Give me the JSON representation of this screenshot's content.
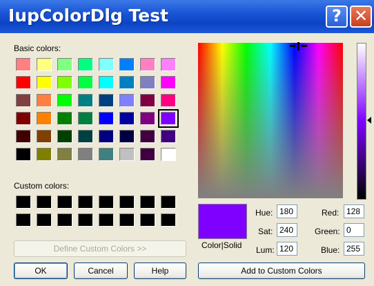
{
  "window": {
    "title": "IupColorDlg Test",
    "help_glyph": "?",
    "close_glyph": "✕"
  },
  "basic_colors": {
    "label": "Basic colors:",
    "rows": [
      [
        "#ff8080",
        "#ffff80",
        "#80ff80",
        "#00ff80",
        "#80ffff",
        "#0080ff",
        "#ff80c0",
        "#ff80ff"
      ],
      [
        "#ff0000",
        "#ffff00",
        "#80ff00",
        "#00ff40",
        "#00ffff",
        "#0080c0",
        "#8080c0",
        "#ff00ff"
      ],
      [
        "#804040",
        "#ff8040",
        "#00ff00",
        "#008080",
        "#004080",
        "#8080ff",
        "#800040",
        "#ff0080"
      ],
      [
        "#800000",
        "#ff8000",
        "#008000",
        "#008040",
        "#0000ff",
        "#0000a0",
        "#800080",
        "#8000ff"
      ],
      [
        "#400000",
        "#804000",
        "#004000",
        "#004040",
        "#000080",
        "#000040",
        "#400040",
        "#400080"
      ],
      [
        "#000000",
        "#808000",
        "#808040",
        "#808080",
        "#408080",
        "#c0c0c0",
        "#400040",
        "#ffffff"
      ]
    ],
    "selected": "#8000ff"
  },
  "custom_colors": {
    "label": "Custom colors:",
    "rows": [
      [
        "#000000",
        "#000000",
        "#000000",
        "#000000",
        "#000000",
        "#000000",
        "#000000",
        "#000000"
      ],
      [
        "#000000",
        "#000000",
        "#000000",
        "#000000",
        "#000000",
        "#000000",
        "#000000",
        "#000000"
      ]
    ]
  },
  "buttons": {
    "define_custom": "Define Custom Colors >>",
    "ok": "OK",
    "cancel": "Cancel",
    "help": "Help",
    "add_custom": "Add to Custom Colors"
  },
  "preview": {
    "label": "Color|Solid",
    "color": "#7f00ff"
  },
  "fields": {
    "hue_label": "Hue:",
    "hue": "180",
    "sat_label": "Sat:",
    "sat": "240",
    "lum_label": "Lum:",
    "lum": "120",
    "red_label": "Red:",
    "red": "128",
    "green_label": "Green:",
    "green": "0",
    "blue_label": "Blue:",
    "blue": "255"
  }
}
